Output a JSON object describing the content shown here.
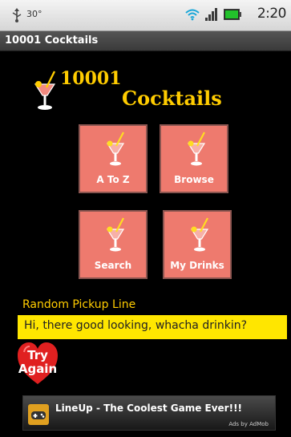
{
  "status_bar": {
    "temperature": "30°",
    "time": "2:20",
    "icons": [
      "usb-icon",
      "wifi-icon",
      "signal-icon",
      "battery-icon"
    ],
    "battery_color": "#22c22b"
  },
  "app": {
    "title": "10001 Cocktails"
  },
  "logo": {
    "line1": "10001",
    "line2": "Cocktails",
    "color": "#ffcc00"
  },
  "tiles": [
    {
      "label": "A To Z",
      "icon": "cocktail-glass-icon"
    },
    {
      "label": "Browse",
      "icon": "cocktail-glass-icon"
    },
    {
      "label": "Search",
      "icon": "cocktail-glass-icon"
    },
    {
      "label": "My Drinks",
      "icon": "cocktail-glass-icon"
    }
  ],
  "tile_color": "#ee7a6e",
  "pickup": {
    "heading": "Random Pickup Line",
    "text": "Hi, there good looking, whacha drinkin?",
    "box_color": "#ffe600"
  },
  "try_again": {
    "line1": "Try",
    "line2": "Again",
    "color": "#e02020"
  },
  "ad": {
    "text": "LineUp - The Coolest Game Ever!!!",
    "attribution": "Ads by AdMob",
    "icon": "gamepad-icon"
  }
}
